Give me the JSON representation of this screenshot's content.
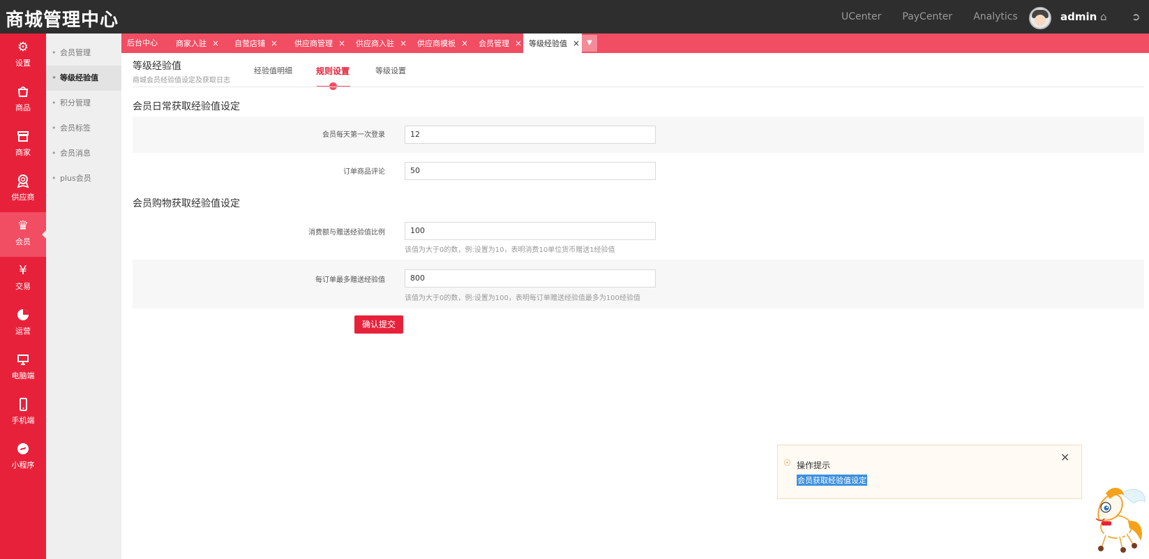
{
  "app": {
    "brand": "商城管理中心",
    "top_links": [
      "UCenter",
      "PayCenter",
      "Analytics"
    ],
    "username": "admin"
  },
  "left_nav": [
    {
      "label": "设置",
      "icon": "gear-icon"
    },
    {
      "label": "商品",
      "icon": "bag-icon"
    },
    {
      "label": "商家",
      "icon": "store-icon"
    },
    {
      "label": "供应商",
      "icon": "badge-icon"
    },
    {
      "label": "会员",
      "icon": "crown-icon",
      "active": true
    },
    {
      "label": "交易",
      "icon": "yen-icon"
    },
    {
      "label": "运营",
      "icon": "pie-icon"
    },
    {
      "label": "电脑端",
      "icon": "monitor-icon"
    },
    {
      "label": "手机端",
      "icon": "phone-icon"
    },
    {
      "label": "小程序",
      "icon": "miniapp-icon"
    }
  ],
  "sub_nav": [
    {
      "label": "会员管理"
    },
    {
      "label": "等级经验值",
      "active": true
    },
    {
      "label": "积分管理"
    },
    {
      "label": "会员标签"
    },
    {
      "label": "会员消息"
    },
    {
      "label": "plus会员"
    }
  ],
  "tabs": [
    {
      "label": "后台中心",
      "closable": false
    },
    {
      "label": "商家入驻",
      "closable": true
    },
    {
      "label": "自营店铺",
      "closable": true
    },
    {
      "label": "供应商管理",
      "closable": true
    },
    {
      "label": "供应商入驻",
      "closable": true
    },
    {
      "label": "供应商模板",
      "closable": true
    },
    {
      "label": "会员管理",
      "closable": true
    },
    {
      "label": "等级经验值",
      "closable": true,
      "active": true
    }
  ],
  "page": {
    "title": "等级经验值",
    "subtitle": "商城会员经验值设定及获取日志",
    "subtabs": [
      "经验值明细",
      "规则设置",
      "等级设置"
    ],
    "active_subtab": "规则设置"
  },
  "form": {
    "section1_title": "会员日常获取经验值设定",
    "section2_title": "会员购物获取经验值设定",
    "daily_login_label": "会员每天第一次登录",
    "daily_login_value": "12",
    "order_review_label": "订单商品评论",
    "order_review_value": "50",
    "ratio_label": "消费额与赠送经验值比例",
    "ratio_value": "100",
    "ratio_hint": "该值为大于0的数，例:设置为10，表明消费10单位货币赠送1经验值",
    "max_label": "每订单最多赠送经验值",
    "max_value": "800",
    "max_hint": "该值为大于0的数，例:设置为100，表明每订单赠送经验值最多为100经验值",
    "submit_label": "确认提交"
  },
  "tip": {
    "title": "操作提示",
    "body": "会员获取经验值设定"
  },
  "colors": {
    "brand_red": "#e8213a",
    "tab_red": "#f14d63",
    "topbar": "#2e2e2e"
  }
}
